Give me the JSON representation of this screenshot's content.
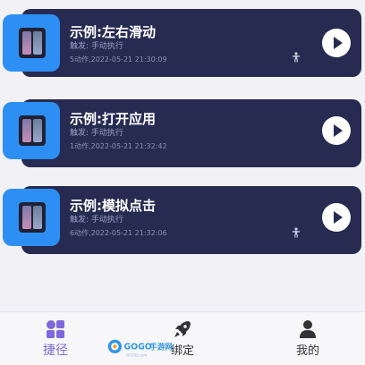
{
  "cards": [
    {
      "title": "示例:左右滑动",
      "trigger": "触发: 手动执行",
      "meta": "5动作,2022-05-21 21:30:09",
      "has_person_icon": true
    },
    {
      "title": "示例:打开应用",
      "trigger": "触发: 手动执行",
      "meta": "1动作,2022-05-21 21:32:42",
      "has_person_icon": false
    },
    {
      "title": "示例:模拟点击",
      "trigger": "触发: 手动执行",
      "meta": "6动作,2022-05-21 21:32:06",
      "has_person_icon": true
    }
  ],
  "tabs": [
    {
      "label": "捷径",
      "icon": "grid-icon",
      "active": true
    },
    {
      "label": "绑定",
      "icon": "rocket-icon",
      "active": false
    },
    {
      "label": "我的",
      "icon": "person-icon",
      "active": false
    }
  ],
  "colors": {
    "card_bg": "#272b52",
    "thumb_bg": "#2d8ff3",
    "tab_active": "#7d68dd",
    "tab_inactive": "#333333",
    "page_bg": "#f1f1f6"
  },
  "watermark": {
    "brand": "GOGO手游网",
    "url": "GOGO.com"
  }
}
